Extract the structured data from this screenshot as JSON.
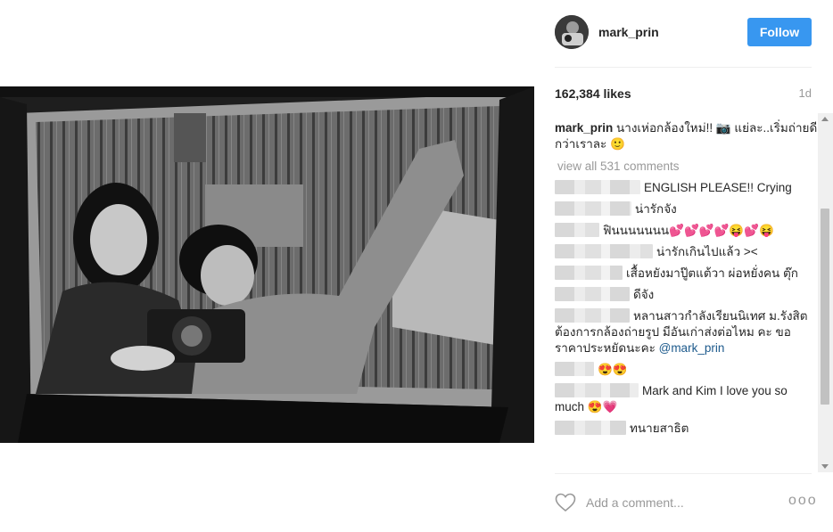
{
  "post": {
    "username": "mark_prin",
    "follow_label": "Follow",
    "likes": "162,384 likes",
    "time": "1d",
    "caption_user": "mark_prin",
    "caption_text": " นางเห่อกล้องใหม่!! 📷 แย่ละ..เริ่มถ่ายดีกว่าเราละ 🙂",
    "view_all": "view all 531 comments",
    "add_comment_placeholder": "Add a comment...",
    "more_label": "ooo"
  },
  "comments": [
    {
      "text": "ENGLISH PLEASE!! Crying"
    },
    {
      "text": "น่ารักจัง"
    },
    {
      "text": "ฟินนนนนนน💕💕💕💕😝💕😝"
    },
    {
      "text": "น่ารักเกินไปแล้ว ><"
    },
    {
      "text": "เสื้อหยังมาปู๊ตแต้วา ผ่อหยั่งคน ตุ๊ก"
    },
    {
      "text": "ดีจัง"
    },
    {
      "text": "หลานสาวกำลังเรียนนิเทศ ม.รังสิต ต้องการกล้องถ่ายรูป มีอันเก่าส่งต่อไหม คะ ขอราคาประหยัดนะคะ ",
      "mention": "@mark_prin"
    },
    {
      "text": "😍😍"
    },
    {
      "text": "Mark and Kim I love you so much 😍💗"
    },
    {
      "text": "ทนายสาธิต"
    }
  ],
  "icons": {
    "like": "heart-icon",
    "more": "more-options-icon"
  },
  "colors": {
    "follow_bg": "#3897f0",
    "muted": "#999999",
    "mention": "#1d5a8c"
  }
}
